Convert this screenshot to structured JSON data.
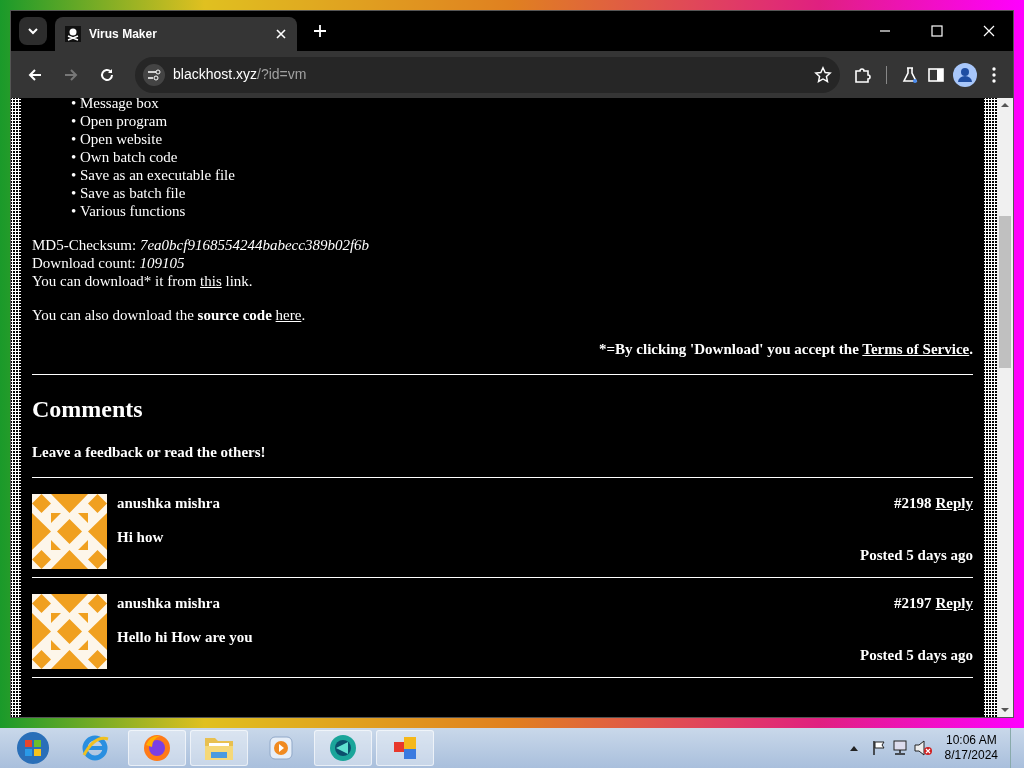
{
  "browser": {
    "tab_title": "Virus Maker",
    "url_host": "blackhost.xyz",
    "url_path": "/?id=vm",
    "forward_disabled": true
  },
  "features": [
    {
      "marker": "•",
      "text": "Message box"
    },
    {
      "marker": "•",
      "text": "Open program"
    },
    {
      "marker": "•",
      "text": "Open website"
    },
    {
      "marker": "•",
      "text": "Own batch code"
    },
    {
      "marker": "•",
      "text": "Save as an executable file"
    },
    {
      "marker": "•",
      "text": "Save as batch file"
    },
    {
      "marker": "•",
      "text": "Various functions"
    }
  ],
  "checksum_line": "MD5-Checksum: *7ea0bcf9168554244babecc389b02f6b*",
  "count_line": "Download count: *109105*",
  "download_line": {
    "before": "You can download* it from",
    "link": "this",
    "after": "link."
  },
  "source_line": {
    "before": "You can also download the **source code**",
    "link": "here",
    "after": "."
  },
  "terms_line": {
    "before": "*=By clicking 'Download' you accept the",
    "link": "Terms of Service",
    "after": "."
  },
  "comments_heading": "Comments",
  "comments_subheading": "Leave a feedback or read the others!",
  "comments": [
    {
      "author": "anushka mishra",
      "text": "Hi how",
      "number": "#2198",
      "reply": "Reply",
      "posted": "Posted 5 days ago"
    },
    {
      "author": "anushka mishra",
      "text": "Hello hi How are you",
      "number": "#2197",
      "reply": "Reply",
      "posted": "Posted 5 days ago"
    }
  ],
  "taskbar": {
    "time": "10:06 AM",
    "date": "8/17/2024"
  }
}
